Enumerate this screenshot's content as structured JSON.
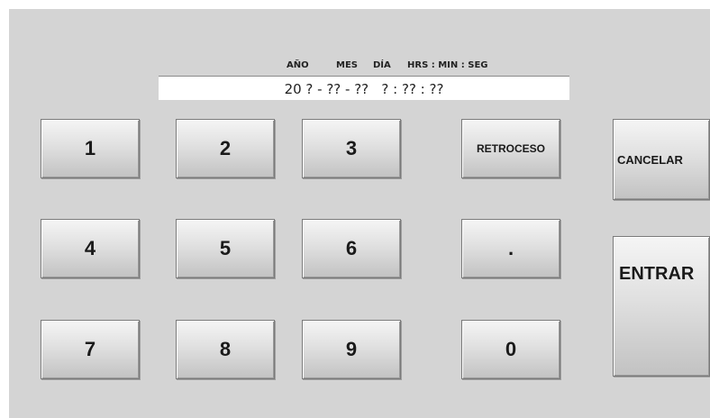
{
  "display": {
    "headers": {
      "year": "AÑO",
      "month": "MES",
      "day": "DÍA",
      "time": "HRS : MIN : SEG"
    },
    "value": "20 ? - ?? - ??   ? : ?? : ??"
  },
  "keypad": {
    "k1": "1",
    "k2": "2",
    "k3": "3",
    "k4": "4",
    "k5": "5",
    "k6": "6",
    "k7": "7",
    "k8": "8",
    "k9": "9",
    "k0": "0",
    "dot": "."
  },
  "actions": {
    "backspace": "RETROCESO",
    "cancel": "CANCELAR",
    "enter": "ENTRAR"
  }
}
